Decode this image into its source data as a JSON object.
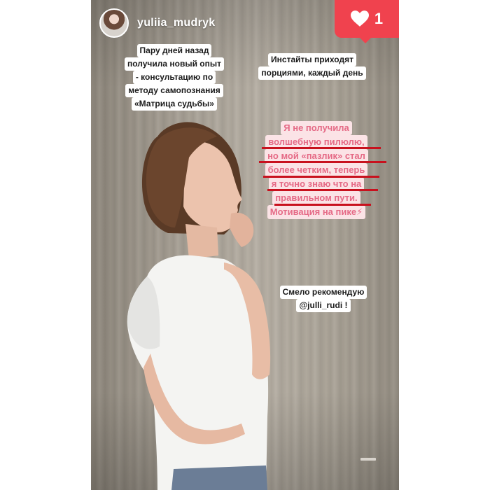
{
  "story": {
    "username": "yuliia_mudryk",
    "like_count": "1",
    "avatar_icon": "profile-avatar",
    "like_icon": "heart-icon",
    "colors": {
      "like_badge": "#f0424e",
      "highlight_pink": "#fbe3e6",
      "highlight_text": "#e56a86",
      "strike_red": "#c8111e"
    }
  },
  "stickers": {
    "left_lines": [
      "Пару дней назад",
      "получила новый опыт",
      "- консультацию по",
      "методу самопознания",
      "«Матрица судьбы»"
    ],
    "right_lines": [
      "Инстайты приходят",
      "порциями, каждый день"
    ],
    "highlight_lines": [
      "Я не получила",
      "волшебную пилюлю,",
      "но мой «пазлик» стал",
      "более четким, теперь",
      "я точно знаю что на",
      "правильном пути.",
      "Мотивация на пике⚡"
    ],
    "recommend_lines": [
      "Смело рекомендую",
      "@julli_rudi !"
    ]
  }
}
